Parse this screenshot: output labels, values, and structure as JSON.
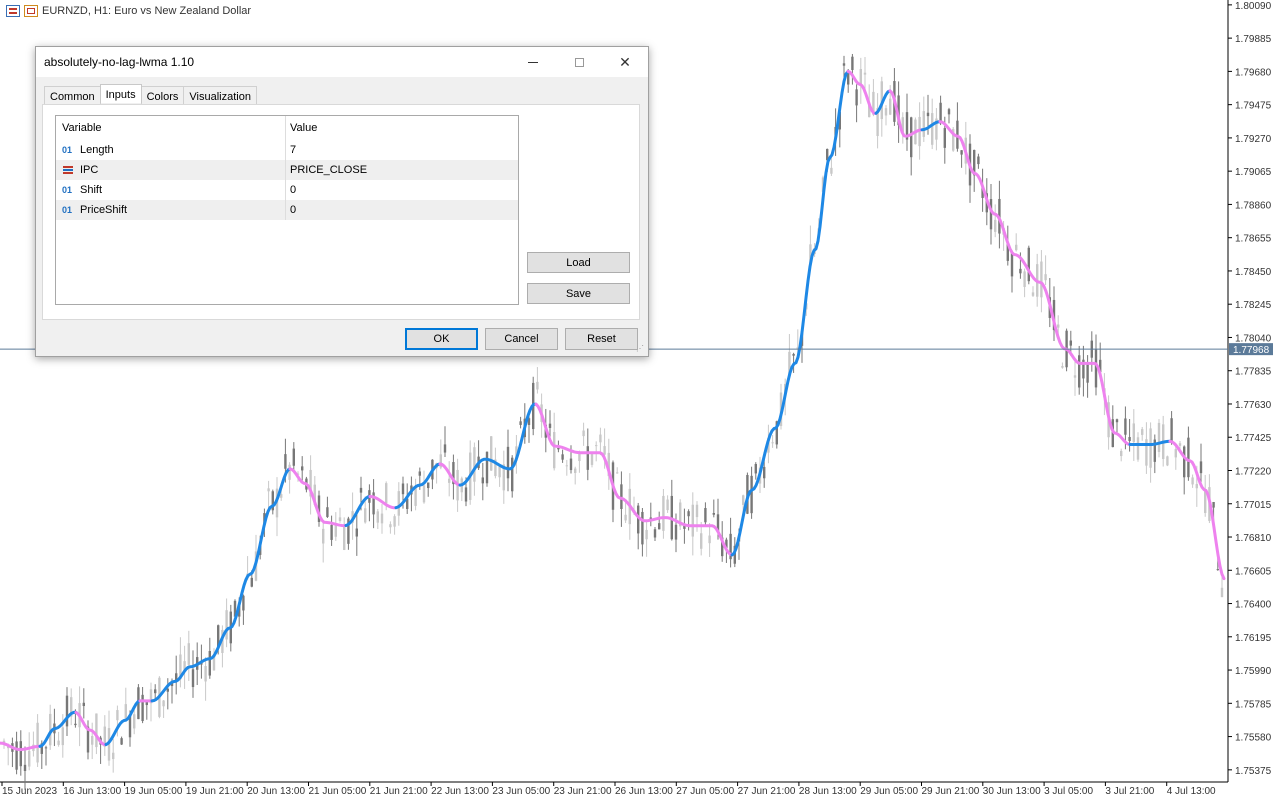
{
  "symbol": {
    "label": "EURNZD, H1:  Euro vs New Zealand Dollar"
  },
  "dialog": {
    "title": "absolutely-no-lag-lwma 1.10",
    "tabs": [
      {
        "label": "Common"
      },
      {
        "label": "Inputs"
      },
      {
        "label": "Colors"
      },
      {
        "label": "Visualization"
      }
    ],
    "grid": {
      "headers": {
        "variable": "Variable",
        "value": "Value"
      },
      "rows": [
        {
          "icon": "01",
          "name": "Length",
          "value": "7"
        },
        {
          "icon": "",
          "name": "IPC",
          "value": "PRICE_CLOSE"
        },
        {
          "icon": "01",
          "name": "Shift",
          "value": "0"
        },
        {
          "icon": "01",
          "name": "PriceShift",
          "value": "0"
        }
      ]
    },
    "buttons": {
      "load": "Load",
      "save": "Save",
      "ok": "OK",
      "cancel": "Cancel",
      "reset": "Reset"
    }
  },
  "chart_data": {
    "type": "candlestick",
    "price_levels": [
      "1.80090",
      "1.79885",
      "1.79680",
      "1.79475",
      "1.79270",
      "1.79065",
      "1.78860",
      "1.78655",
      "1.78450",
      "1.78245",
      "1.78040",
      "1.77835",
      "1.77630",
      "1.77425",
      "1.77220",
      "1.77015",
      "1.76810",
      "1.76605",
      "1.76400",
      "1.76195",
      "1.75990",
      "1.75785",
      "1.75580",
      "1.75375"
    ],
    "current_price": "1.77968",
    "time_labels": [
      "15 Jun 2023",
      "16 Jun 13:00",
      "19 Jun 05:00",
      "19 Jun 21:00",
      "20 Jun 13:00",
      "21 Jun 05:00",
      "21 Jun 21:00",
      "22 Jun 13:00",
      "23 Jun 05:00",
      "23 Jun 21:00",
      "26 Jun 13:00",
      "27 Jun 05:00",
      "27 Jun 21:00",
      "28 Jun 13:00",
      "29 Jun 05:00",
      "29 Jun 21:00",
      "30 Jun 13:00",
      "3 Jul 05:00",
      "3 Jul 21:00",
      "4 Jul 13:00"
    ],
    "ylim": [
      1.753,
      1.8012
    ],
    "colors": {
      "up": "#1e88e5",
      "down": "#ee82ee",
      "candle_up": "#c8c8c8",
      "candle_down": "#777777",
      "price_line": "#5b7a99"
    },
    "line_anchors": [
      [
        0,
        1.7554
      ],
      [
        20,
        1.755
      ],
      [
        40,
        1.7552
      ],
      [
        55,
        1.7563
      ],
      [
        75,
        1.7573
      ],
      [
        90,
        1.7562
      ],
      [
        105,
        1.7553
      ],
      [
        125,
        1.7568
      ],
      [
        140,
        1.758
      ],
      [
        152,
        1.758
      ],
      [
        175,
        1.7592
      ],
      [
        190,
        1.7601
      ],
      [
        210,
        1.7606
      ],
      [
        230,
        1.7625
      ],
      [
        250,
        1.7658
      ],
      [
        272,
        1.77
      ],
      [
        290,
        1.7723
      ],
      [
        305,
        1.7714
      ],
      [
        325,
        1.769
      ],
      [
        345,
        1.7688
      ],
      [
        370,
        1.7706
      ],
      [
        395,
        1.7699
      ],
      [
        420,
        1.7713
      ],
      [
        440,
        1.7726
      ],
      [
        460,
        1.7713
      ],
      [
        485,
        1.7729
      ],
      [
        510,
        1.7723
      ],
      [
        535,
        1.7763
      ],
      [
        555,
        1.7737
      ],
      [
        580,
        1.7733
      ],
      [
        600,
        1.7733
      ],
      [
        620,
        1.7705
      ],
      [
        645,
        1.7691
      ],
      [
        665,
        1.7693
      ],
      [
        690,
        1.7688
      ],
      [
        712,
        1.7688
      ],
      [
        732,
        1.767
      ],
      [
        752,
        1.771
      ],
      [
        775,
        1.7748
      ],
      [
        795,
        1.7788
      ],
      [
        815,
        1.7858
      ],
      [
        830,
        1.7915
      ],
      [
        848,
        1.7968
      ],
      [
        860,
        1.796
      ],
      [
        875,
        1.7942
      ],
      [
        890,
        1.7956
      ],
      [
        905,
        1.7928
      ],
      [
        922,
        1.7932
      ],
      [
        940,
        1.7937
      ],
      [
        958,
        1.7928
      ],
      [
        975,
        1.7905
      ],
      [
        995,
        1.788
      ],
      [
        1015,
        1.7855
      ],
      [
        1040,
        1.7838
      ],
      [
        1065,
        1.7797
      ],
      [
        1080,
        1.7788
      ],
      [
        1095,
        1.7788
      ],
      [
        1115,
        1.7745
      ],
      [
        1130,
        1.7738
      ],
      [
        1150,
        1.7738
      ],
      [
        1170,
        1.774
      ],
      [
        1190,
        1.7728
      ],
      [
        1205,
        1.771
      ],
      [
        1225,
        1.7655
      ]
    ],
    "line_up_segments": [
      [
        40,
        75
      ],
      [
        105,
        140
      ],
      [
        152,
        290
      ],
      [
        345,
        370
      ],
      [
        395,
        440
      ],
      [
        460,
        535
      ],
      [
        732,
        848
      ],
      [
        875,
        890
      ],
      [
        922,
        940
      ],
      [
        1130,
        1170
      ]
    ]
  }
}
